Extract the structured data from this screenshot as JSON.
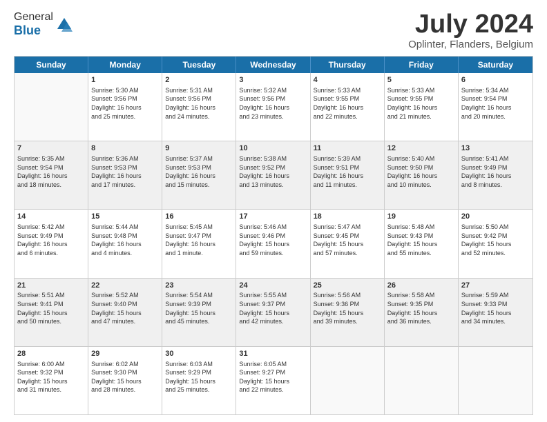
{
  "header": {
    "logo_general": "General",
    "logo_blue": "Blue",
    "month_title": "July 2024",
    "location": "Oplinter, Flanders, Belgium"
  },
  "days_of_week": [
    "Sunday",
    "Monday",
    "Tuesday",
    "Wednesday",
    "Thursday",
    "Friday",
    "Saturday"
  ],
  "rows": [
    {
      "cells": [
        {
          "day": "",
          "info": "",
          "empty": true
        },
        {
          "day": "1",
          "info": "Sunrise: 5:30 AM\nSunset: 9:56 PM\nDaylight: 16 hours\nand 25 minutes."
        },
        {
          "day": "2",
          "info": "Sunrise: 5:31 AM\nSunset: 9:56 PM\nDaylight: 16 hours\nand 24 minutes."
        },
        {
          "day": "3",
          "info": "Sunrise: 5:32 AM\nSunset: 9:56 PM\nDaylight: 16 hours\nand 23 minutes."
        },
        {
          "day": "4",
          "info": "Sunrise: 5:33 AM\nSunset: 9:55 PM\nDaylight: 16 hours\nand 22 minutes."
        },
        {
          "day": "5",
          "info": "Sunrise: 5:33 AM\nSunset: 9:55 PM\nDaylight: 16 hours\nand 21 minutes."
        },
        {
          "day": "6",
          "info": "Sunrise: 5:34 AM\nSunset: 9:54 PM\nDaylight: 16 hours\nand 20 minutes."
        }
      ]
    },
    {
      "cells": [
        {
          "day": "7",
          "info": "Sunrise: 5:35 AM\nSunset: 9:54 PM\nDaylight: 16 hours\nand 18 minutes.",
          "shaded": true
        },
        {
          "day": "8",
          "info": "Sunrise: 5:36 AM\nSunset: 9:53 PM\nDaylight: 16 hours\nand 17 minutes.",
          "shaded": true
        },
        {
          "day": "9",
          "info": "Sunrise: 5:37 AM\nSunset: 9:53 PM\nDaylight: 16 hours\nand 15 minutes.",
          "shaded": true
        },
        {
          "day": "10",
          "info": "Sunrise: 5:38 AM\nSunset: 9:52 PM\nDaylight: 16 hours\nand 13 minutes.",
          "shaded": true
        },
        {
          "day": "11",
          "info": "Sunrise: 5:39 AM\nSunset: 9:51 PM\nDaylight: 16 hours\nand 11 minutes.",
          "shaded": true
        },
        {
          "day": "12",
          "info": "Sunrise: 5:40 AM\nSunset: 9:50 PM\nDaylight: 16 hours\nand 10 minutes.",
          "shaded": true
        },
        {
          "day": "13",
          "info": "Sunrise: 5:41 AM\nSunset: 9:49 PM\nDaylight: 16 hours\nand 8 minutes.",
          "shaded": true
        }
      ]
    },
    {
      "cells": [
        {
          "day": "14",
          "info": "Sunrise: 5:42 AM\nSunset: 9:49 PM\nDaylight: 16 hours\nand 6 minutes."
        },
        {
          "day": "15",
          "info": "Sunrise: 5:44 AM\nSunset: 9:48 PM\nDaylight: 16 hours\nand 4 minutes."
        },
        {
          "day": "16",
          "info": "Sunrise: 5:45 AM\nSunset: 9:47 PM\nDaylight: 16 hours\nand 1 minute."
        },
        {
          "day": "17",
          "info": "Sunrise: 5:46 AM\nSunset: 9:46 PM\nDaylight: 15 hours\nand 59 minutes."
        },
        {
          "day": "18",
          "info": "Sunrise: 5:47 AM\nSunset: 9:45 PM\nDaylight: 15 hours\nand 57 minutes."
        },
        {
          "day": "19",
          "info": "Sunrise: 5:48 AM\nSunset: 9:43 PM\nDaylight: 15 hours\nand 55 minutes."
        },
        {
          "day": "20",
          "info": "Sunrise: 5:50 AM\nSunset: 9:42 PM\nDaylight: 15 hours\nand 52 minutes."
        }
      ]
    },
    {
      "cells": [
        {
          "day": "21",
          "info": "Sunrise: 5:51 AM\nSunset: 9:41 PM\nDaylight: 15 hours\nand 50 minutes.",
          "shaded": true
        },
        {
          "day": "22",
          "info": "Sunrise: 5:52 AM\nSunset: 9:40 PM\nDaylight: 15 hours\nand 47 minutes.",
          "shaded": true
        },
        {
          "day": "23",
          "info": "Sunrise: 5:54 AM\nSunset: 9:39 PM\nDaylight: 15 hours\nand 45 minutes.",
          "shaded": true
        },
        {
          "day": "24",
          "info": "Sunrise: 5:55 AM\nSunset: 9:37 PM\nDaylight: 15 hours\nand 42 minutes.",
          "shaded": true
        },
        {
          "day": "25",
          "info": "Sunrise: 5:56 AM\nSunset: 9:36 PM\nDaylight: 15 hours\nand 39 minutes.",
          "shaded": true
        },
        {
          "day": "26",
          "info": "Sunrise: 5:58 AM\nSunset: 9:35 PM\nDaylight: 15 hours\nand 36 minutes.",
          "shaded": true
        },
        {
          "day": "27",
          "info": "Sunrise: 5:59 AM\nSunset: 9:33 PM\nDaylight: 15 hours\nand 34 minutes.",
          "shaded": true
        }
      ]
    },
    {
      "cells": [
        {
          "day": "28",
          "info": "Sunrise: 6:00 AM\nSunset: 9:32 PM\nDaylight: 15 hours\nand 31 minutes."
        },
        {
          "day": "29",
          "info": "Sunrise: 6:02 AM\nSunset: 9:30 PM\nDaylight: 15 hours\nand 28 minutes."
        },
        {
          "day": "30",
          "info": "Sunrise: 6:03 AM\nSunset: 9:29 PM\nDaylight: 15 hours\nand 25 minutes."
        },
        {
          "day": "31",
          "info": "Sunrise: 6:05 AM\nSunset: 9:27 PM\nDaylight: 15 hours\nand 22 minutes."
        },
        {
          "day": "",
          "info": "",
          "empty": true
        },
        {
          "day": "",
          "info": "",
          "empty": true
        },
        {
          "day": "",
          "info": "",
          "empty": true
        }
      ]
    }
  ]
}
